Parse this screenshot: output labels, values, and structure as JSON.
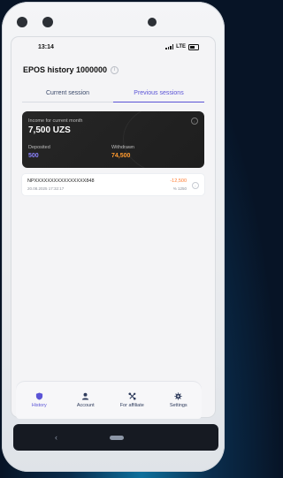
{
  "status_bar": {
    "time": "13:14",
    "network": "LTE"
  },
  "page": {
    "title": "EPOS history 1000000"
  },
  "tabs": [
    {
      "label": "Current session",
      "active": false
    },
    {
      "label": "Previous sessions",
      "active": true
    }
  ],
  "summary_card": {
    "income_label": "Income for current month",
    "income_value": "7,500 UZS",
    "deposited_label": "Deposited",
    "deposited_value": "500",
    "withdrawn_label": "Withdrawn",
    "withdrawn_value": "74,500"
  },
  "transactions": [
    {
      "id": "NPXXXXXXXXXXXXXXXX848",
      "datetime": "20.08.2025 17:32:17",
      "amount": "-12,500",
      "fee": "% 1250"
    }
  ],
  "nav": {
    "items": [
      {
        "label": "History",
        "icon": "shield-icon",
        "active": true
      },
      {
        "label": "Account",
        "icon": "user-icon",
        "active": false
      },
      {
        "label": "For affiliate",
        "icon": "share-icon",
        "active": false
      },
      {
        "label": "Settings",
        "icon": "gear-icon",
        "active": false
      }
    ]
  },
  "colors": {
    "accent": "#5b54d6",
    "deposited": "#8c83ff",
    "withdrawn": "#ff9a2e",
    "negative": "#ff7a2f",
    "card_bg": "#222222"
  }
}
